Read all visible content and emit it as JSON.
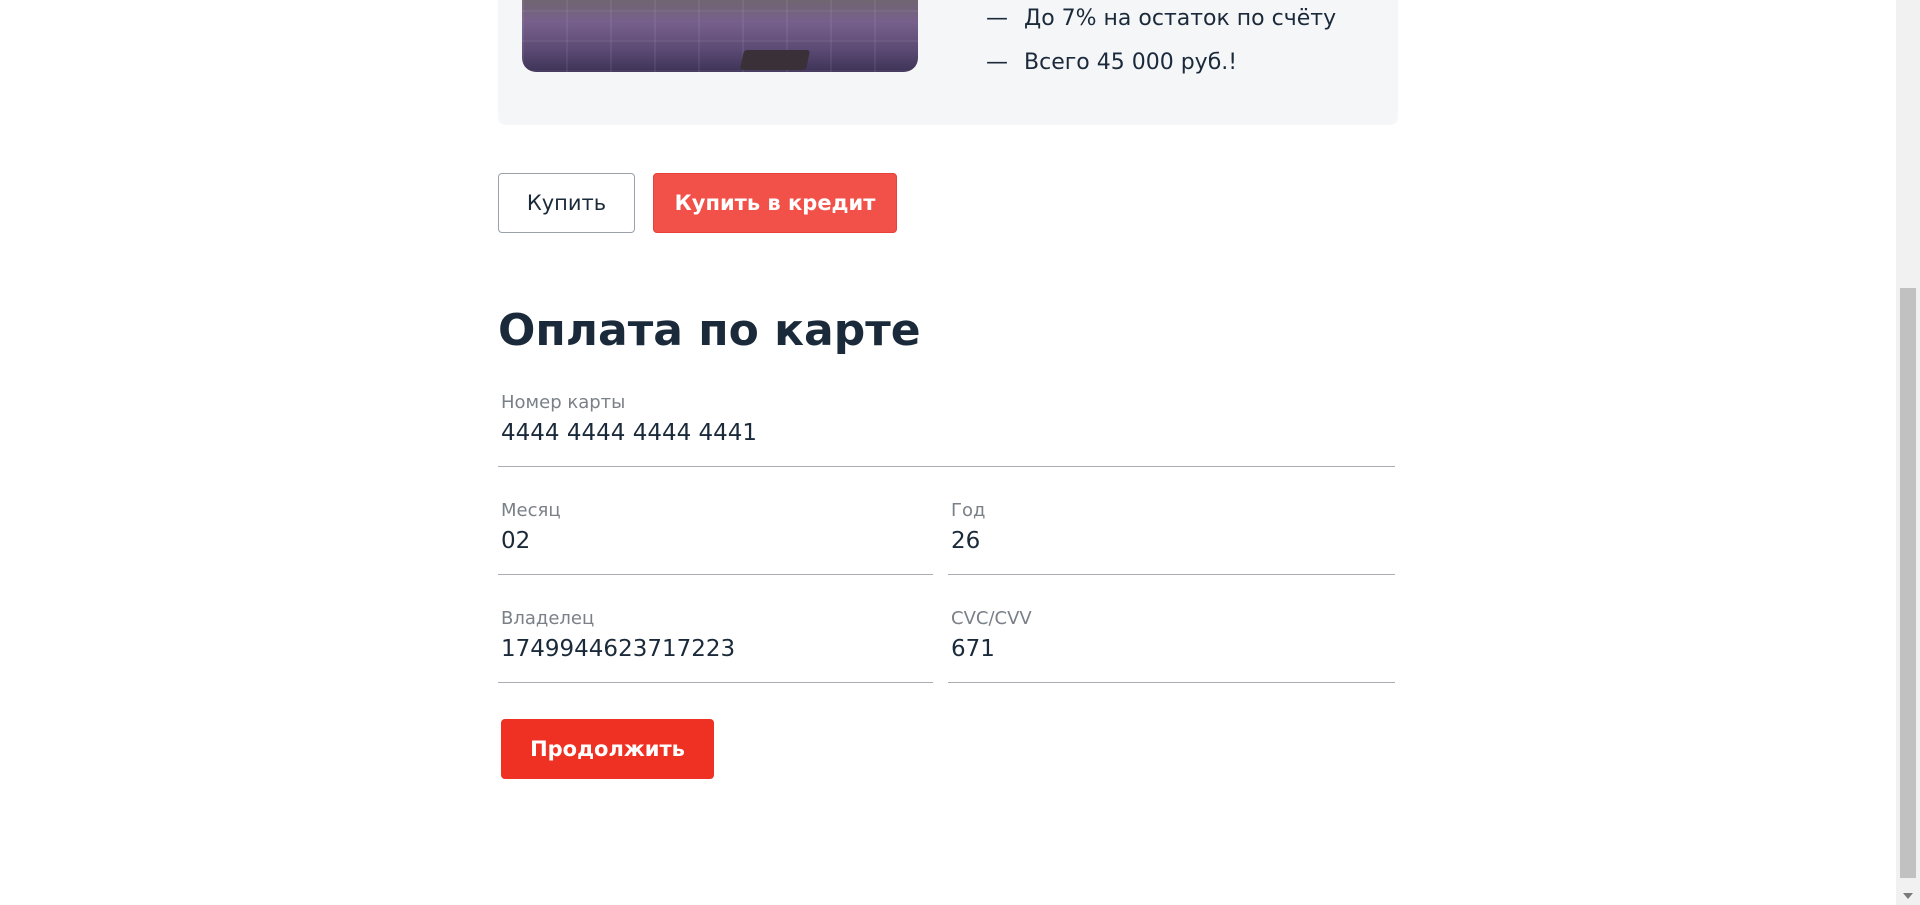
{
  "offer": {
    "items": [
      {
        "dash": "—",
        "text": "До 7% на остаток по счёту"
      },
      {
        "dash": "—",
        "text": "Всего 45 000 руб.!"
      }
    ]
  },
  "buttons": {
    "buy": "Купить",
    "buy_credit": "Купить в кредит",
    "continue": "Продолжить"
  },
  "payment": {
    "title": "Оплата по карте",
    "card_number": {
      "label": "Номер карты",
      "value": "4444 4444 4444 4441"
    },
    "month": {
      "label": "Месяц",
      "value": "02"
    },
    "year": {
      "label": "Год",
      "value": "26"
    },
    "owner": {
      "label": "Владелец",
      "value": "1749944623717223"
    },
    "cvc": {
      "label": "CVC/CVV",
      "value": "671"
    }
  },
  "colors": {
    "primary": "#ef3124",
    "primary_light": "#f15149",
    "text": "#1b2a3a",
    "muted": "#7a8087",
    "card_bg": "#f5f6f8"
  },
  "icons": {
    "scroll_down": "chevron-down-icon"
  }
}
